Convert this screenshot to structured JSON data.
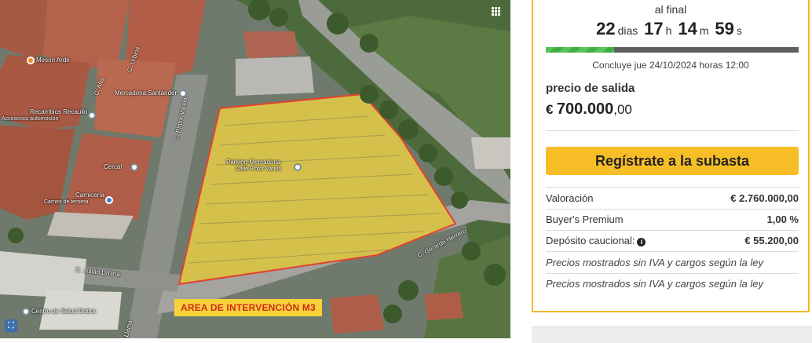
{
  "map": {
    "area_label": "AREA DE INTERVENCIÓN M3",
    "labels": {
      "meson": "Mesón Arde",
      "mercadona": "Mercadona Santander",
      "recambios": "Recambios Recaulio",
      "recambios_sub": "Accesorios automoción",
      "cecal": "Cercal",
      "carniceria": "Carnicería",
      "carniceria_sub": "Carnes de ternera",
      "parking": "Parking Mercadona",
      "parking_sub": "Calle Pintor Varela",
      "centro_salud": "Centro de Salud Dobra",
      "street_pintor": "C. Pintor Varela",
      "street_julian": "C. Julián Urbina",
      "street_gerardo": "C. Gerardo Herrero",
      "street_alta": "C. Alta",
      "street_urbano": "C. Urbina",
      "street_llama": "Llama"
    },
    "icons": {
      "grid": "grid-icon",
      "streetview": "streetview-icon"
    }
  },
  "auction": {
    "al_final": "al final",
    "countdown": {
      "days": "22",
      "days_unit": "dias",
      "hours": "17",
      "hours_unit": "h",
      "minutes": "14",
      "minutes_unit": "m",
      "seconds": "59",
      "seconds_unit": "s"
    },
    "progress_fraction": 0.27,
    "concluye": "Concluye jue 24/10/2024 horas 12:00",
    "precio_label": "precio de salida",
    "precio": {
      "currency": "€",
      "integer": "700.000",
      "decimals": ",00"
    },
    "register_button": "Regístrate a la subasta",
    "rows": [
      {
        "key": "Valoración",
        "value": "€ 2.760.000,00"
      },
      {
        "key": "Buyer's Premium",
        "value": "1,00 %"
      },
      {
        "key": "Depósito caucional:",
        "value": "€ 55.200,00"
      }
    ],
    "notes": [
      "Precios mostrados sin IVA y cargos según la ley",
      "Precios mostrados sin IVA y cargos según la ley"
    ],
    "colors": {
      "accent": "#f7bd27",
      "border": "#f5b728",
      "progress": "#4cba50",
      "track": "#5f5f5f"
    }
  }
}
